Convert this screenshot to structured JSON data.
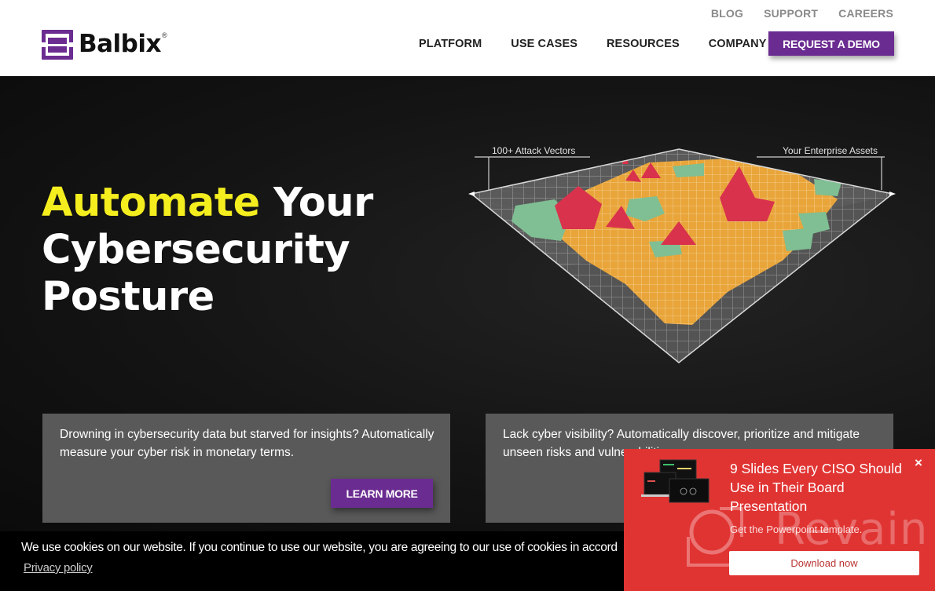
{
  "header": {
    "brand": "Balbix",
    "brand_mark": "®",
    "top_links": [
      "BLOG",
      "SUPPORT",
      "CAREERS"
    ],
    "nav": [
      "PLATFORM",
      "USE CASES",
      "RESOURCES",
      "COMPANY"
    ],
    "cta": "REQUEST A DEMO"
  },
  "hero": {
    "headline_accent": "Automate",
    "headline_rest_line1": " Your",
    "headline_line2": "Cybersecurity",
    "headline_line3": "Posture",
    "viz_labels": {
      "left": "100+ Attack Vectors",
      "right": "Your Enterprise Assets"
    }
  },
  "cards": [
    {
      "text": "Drowning in cybersecurity data but starved for insights? Automatically measure your cyber risk in monetary terms.",
      "button": "LEARN MORE"
    },
    {
      "text": "Lack cyber visibility? Automatically discover, prioritize and mitigate unseen risks and vulnerabilities."
    }
  ],
  "cookie": {
    "text": "We use cookies on our website. If you continue to use our website, you are agreeing to our use of cookies in accord",
    "privacy_link": "Privacy policy"
  },
  "popup": {
    "title": "9 Slides Every CISO Should Use in Their Board Presentation",
    "subtitle": "Get the Powerpoint template.",
    "button": "Download now",
    "close": "×",
    "watermark": "Revain"
  },
  "colors": {
    "brand_purple": "#6b2c91",
    "accent_yellow": "#f5ee1f",
    "popup_red": "#e03433",
    "card_gray": "#595959"
  }
}
